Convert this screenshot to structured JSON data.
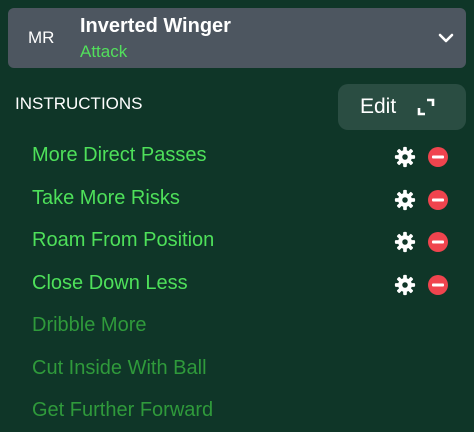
{
  "role": {
    "position_code": "MR",
    "name": "Inverted Winger",
    "duty": "Attack",
    "chevron_icon": "chevron-down-icon"
  },
  "instructions": {
    "title": "INSTRUCTIONS",
    "edit_label": "Edit",
    "edit_icon": "expand-icon",
    "active": [
      {
        "label": "More Direct Passes"
      },
      {
        "label": "Take More Risks"
      },
      {
        "label": "Roam From Position"
      },
      {
        "label": "Close Down Less"
      }
    ],
    "suggested": [
      {
        "label": "Dribble More"
      },
      {
        "label": "Cut Inside With Ball"
      },
      {
        "label": "Get Further Forward"
      }
    ]
  },
  "colors": {
    "background": "#0f3628",
    "header_bg": "#4d5660",
    "active_text": "#4ee05a",
    "suggested_text": "#2f9a3b",
    "remove": "#f0444e"
  }
}
